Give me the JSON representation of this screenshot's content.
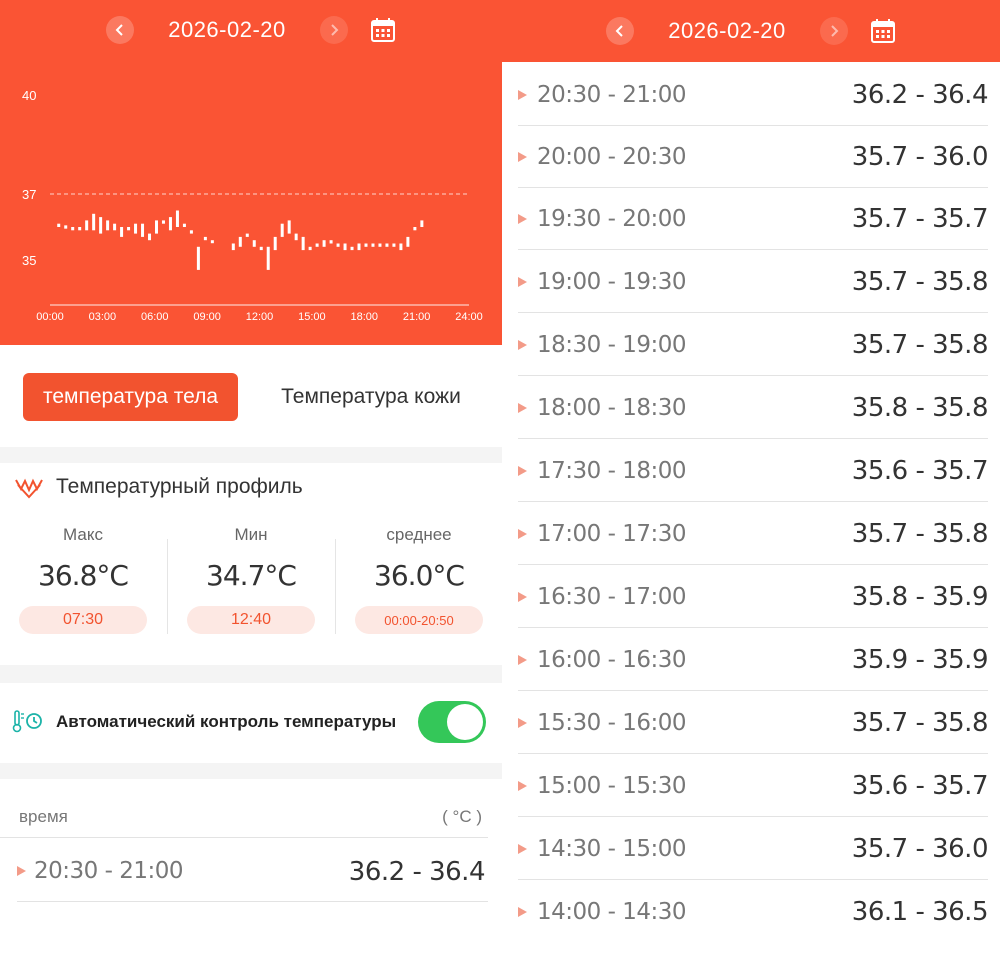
{
  "left": {
    "header": {
      "date": "2026-02-20"
    },
    "chart_data": {
      "type": "bar",
      "y_tick_labels": [
        "40",
        "37",
        "35"
      ],
      "x_tick_labels": [
        "00:00",
        "03:00",
        "06:00",
        "09:00",
        "12:00",
        "15:00",
        "18:00",
        "21:00",
        "24:00"
      ],
      "reference_line": 37,
      "ylim": [
        34,
        40
      ],
      "xlim": [
        0,
        24
      ],
      "bars": [
        {
          "x": 0.5,
          "low": 36.0,
          "high": 36.1
        },
        {
          "x": 0.9,
          "low": 35.95,
          "high": 36.05
        },
        {
          "x": 1.3,
          "low": 35.9,
          "high": 36.0
        },
        {
          "x": 1.7,
          "low": 35.9,
          "high": 36.0
        },
        {
          "x": 2.1,
          "low": 35.9,
          "high": 36.2
        },
        {
          "x": 2.5,
          "low": 35.9,
          "high": 36.4
        },
        {
          "x": 2.9,
          "low": 35.8,
          "high": 36.3
        },
        {
          "x": 3.3,
          "low": 35.9,
          "high": 36.2
        },
        {
          "x": 3.7,
          "low": 35.9,
          "high": 36.1
        },
        {
          "x": 4.1,
          "low": 35.7,
          "high": 36.0
        },
        {
          "x": 4.5,
          "low": 35.9,
          "high": 36.0
        },
        {
          "x": 4.9,
          "low": 35.8,
          "high": 36.1
        },
        {
          "x": 5.3,
          "low": 35.7,
          "high": 36.1
        },
        {
          "x": 5.7,
          "low": 35.6,
          "high": 35.8
        },
        {
          "x": 6.1,
          "low": 35.8,
          "high": 36.2
        },
        {
          "x": 6.5,
          "low": 36.1,
          "high": 36.2
        },
        {
          "x": 6.9,
          "low": 35.9,
          "high": 36.3
        },
        {
          "x": 7.3,
          "low": 36.0,
          "high": 36.5
        },
        {
          "x": 7.7,
          "low": 36.0,
          "high": 36.1
        },
        {
          "x": 8.1,
          "low": 35.8,
          "high": 35.9
        },
        {
          "x": 8.5,
          "low": 34.7,
          "high": 35.4
        },
        {
          "x": 8.9,
          "low": 35.6,
          "high": 35.7
        },
        {
          "x": 9.3,
          "low": 35.6,
          "high": 35.6
        },
        {
          "x": 10.5,
          "low": 35.3,
          "high": 35.5
        },
        {
          "x": 10.9,
          "low": 35.4,
          "high": 35.7
        },
        {
          "x": 11.3,
          "low": 35.7,
          "high": 35.8
        },
        {
          "x": 11.7,
          "low": 35.4,
          "high": 35.6
        },
        {
          "x": 12.1,
          "low": 35.3,
          "high": 35.4
        },
        {
          "x": 12.5,
          "low": 34.7,
          "high": 35.4
        },
        {
          "x": 12.9,
          "low": 35.3,
          "high": 35.7
        },
        {
          "x": 13.3,
          "low": 35.7,
          "high": 36.1
        },
        {
          "x": 13.7,
          "low": 35.8,
          "high": 36.2
        },
        {
          "x": 14.1,
          "low": 35.6,
          "high": 35.8
        },
        {
          "x": 14.5,
          "low": 35.3,
          "high": 35.7
        },
        {
          "x": 14.9,
          "low": 35.3,
          "high": 35.4
        },
        {
          "x": 15.3,
          "low": 35.4,
          "high": 35.5
        },
        {
          "x": 15.7,
          "low": 35.4,
          "high": 35.6
        },
        {
          "x": 16.1,
          "low": 35.5,
          "high": 35.6
        },
        {
          "x": 16.5,
          "low": 35.4,
          "high": 35.5
        },
        {
          "x": 16.9,
          "low": 35.3,
          "high": 35.5
        },
        {
          "x": 17.3,
          "low": 35.3,
          "high": 35.4
        },
        {
          "x": 17.7,
          "low": 35.3,
          "high": 35.5
        },
        {
          "x": 18.1,
          "low": 35.4,
          "high": 35.5
        },
        {
          "x": 18.5,
          "low": 35.4,
          "high": 35.5
        },
        {
          "x": 18.9,
          "low": 35.4,
          "high": 35.5
        },
        {
          "x": 19.3,
          "low": 35.4,
          "high": 35.5
        },
        {
          "x": 19.7,
          "low": 35.4,
          "high": 35.5
        },
        {
          "x": 20.1,
          "low": 35.3,
          "high": 35.5
        },
        {
          "x": 20.5,
          "low": 35.4,
          "high": 35.7
        },
        {
          "x": 20.9,
          "low": 35.9,
          "high": 36.0
        },
        {
          "x": 21.3,
          "low": 36.0,
          "high": 36.2
        }
      ]
    },
    "tabs": {
      "active": "температура тела",
      "inactive": "Температура кожи"
    },
    "profile": {
      "title": "Температурный профиль",
      "max": {
        "label": "Макс",
        "value": "36.8°C",
        "time": "07:30"
      },
      "min": {
        "label": "Мин",
        "value": "34.7°C",
        "time": "12:40"
      },
      "avg": {
        "label": "среднее",
        "value": "36.0°C",
        "time": "00:00-20:50"
      }
    },
    "auto_control": {
      "label": "Автоматический контроль температуры",
      "enabled": true
    },
    "table": {
      "col_time": "время",
      "col_unit": "( °C )",
      "rows": [
        {
          "time": "20:30 - 21:00",
          "value": "36.2 - 36.4"
        }
      ]
    }
  },
  "right": {
    "header": {
      "date": "2026-02-20"
    },
    "rows": [
      {
        "time": "20:30 - 21:00",
        "value": "36.2 - 36.4"
      },
      {
        "time": "20:00 - 20:30",
        "value": "35.7 - 36.0"
      },
      {
        "time": "19:30 - 20:00",
        "value": "35.7 - 35.7"
      },
      {
        "time": "19:00 - 19:30",
        "value": "35.7 - 35.8"
      },
      {
        "time": "18:30 - 19:00",
        "value": "35.7 - 35.8"
      },
      {
        "time": "18:00 - 18:30",
        "value": "35.8 - 35.8"
      },
      {
        "time": "17:30 - 18:00",
        "value": "35.6 - 35.7"
      },
      {
        "time": "17:00 - 17:30",
        "value": "35.7 - 35.8"
      },
      {
        "time": "16:30 - 17:00",
        "value": "35.8 - 35.9"
      },
      {
        "time": "16:00 - 16:30",
        "value": "35.9 - 35.9"
      },
      {
        "time": "15:30 - 16:00",
        "value": "35.7 - 35.8"
      },
      {
        "time": "15:00 - 15:30",
        "value": "35.6 - 35.7"
      },
      {
        "time": "14:30 - 15:00",
        "value": "35.7 - 36.0"
      },
      {
        "time": "14:00 - 14:30",
        "value": "36.1 - 36.5"
      }
    ]
  },
  "colors": {
    "accent": "#fa5434",
    "pill_bg": "#fde8e3",
    "toggle_on": "#34c759",
    "row_marker": "#f39b88"
  }
}
